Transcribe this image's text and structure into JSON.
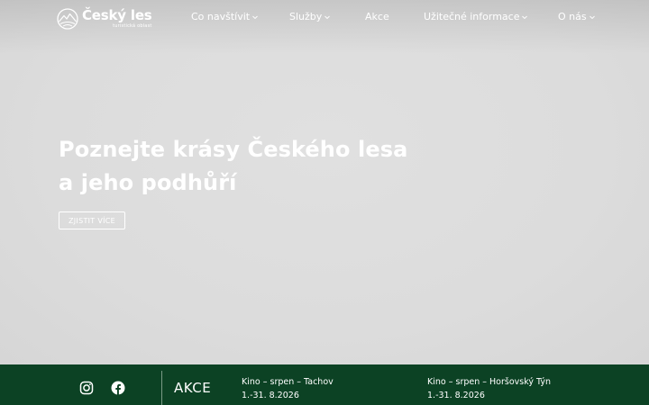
{
  "brand": {
    "title": "Český les",
    "subtitle": "turistická oblast"
  },
  "nav": [
    {
      "label": "Co navštívit",
      "dropdown": true
    },
    {
      "label": "Služby",
      "dropdown": true
    },
    {
      "label": "Akce",
      "dropdown": false
    },
    {
      "label": "Užitečné informace",
      "dropdown": true
    },
    {
      "label": "O nás",
      "dropdown": true
    }
  ],
  "hero": {
    "title_line1": "Poznejte krásy Českého lesa",
    "title_line2": "a jeho podhůří",
    "button_label": "ZJISTIT VÍCE"
  },
  "events_bar": {
    "heading": "AKCE",
    "social_icons": [
      "instagram-icon",
      "facebook-icon"
    ],
    "events": [
      {
        "title": "Kino – srpen – Tachov",
        "date": "1.-31. 8.2026"
      },
      {
        "title": "Kino – srpen – Horšovský Týn",
        "date": "1.-31. 8.2026"
      }
    ]
  },
  "colors": {
    "hero_bg": "#dedede",
    "bar_bg": "#0c4224",
    "text": "#ffffff"
  }
}
